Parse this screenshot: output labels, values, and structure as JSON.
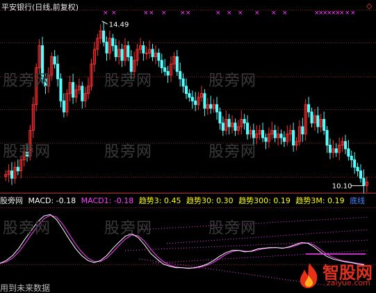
{
  "stock": {
    "title": "平安银行(日线,前复权)",
    "top_right_marker": "◇"
  },
  "watermarks": [
    "股旁网",
    "股旁网",
    "股旁网",
    "股旁网",
    "股旁网",
    "股旁网",
    "股旁网",
    "股旁网",
    "股旁网"
  ],
  "indicator": {
    "name": "股旁网",
    "macd": "MACD: -0.18",
    "macd1": "MACD1: -0.18",
    "trend3": "趋势3: 0.45",
    "trend30": "趋势30: 0.30",
    "trend300": "趋势300: 0.19",
    "trend3m": "趋势3M: 0.19",
    "bottom_line": "底线"
  },
  "bottom_note": "用到未来数据",
  "logo": {
    "name": "智股网",
    "url": "zaiyue.com"
  },
  "colors": {
    "up": "#ff3030",
    "down": "#54ffff",
    "grid": "#8b1a1a",
    "marker": "#ff40ff",
    "macd": "#ffffff",
    "macd1": "#ff40ff",
    "trend3": "#ffff00",
    "trend30": "#ffff00",
    "trend300": "#ffff00",
    "trend3m": "#ffff00",
    "bottom_line": "#4488ff"
  },
  "chart_data": {
    "type": "candlestick",
    "price_labels": {
      "high": "14.49",
      "low": "10.10"
    },
    "price_range": [
      10.0,
      14.8
    ],
    "high": 14.49,
    "low": 10.1,
    "closes": [
      10.4,
      10.5,
      10.3,
      10.6,
      10.5,
      10.8,
      11.0,
      10.9,
      11.6,
      12.3,
      13.3,
      13.9,
      13.0,
      12.8,
      13.1,
      13.6,
      13.4,
      13.0,
      12.4,
      12.1,
      12.6,
      12.9,
      12.5,
      12.7,
      12.8,
      12.4,
      12.6,
      12.8,
      13.4,
      13.8,
      14.1,
      14.3,
      14.0,
      13.7,
      14.1,
      13.9,
      13.6,
      13.8,
      13.5,
      13.9,
      13.6,
      13.2,
      13.5,
      13.8,
      13.9,
      13.7,
      13.7,
      13.8,
      13.6,
      13.7,
      13.5,
      13.3,
      13.2,
      13.1,
      13.4,
      13.6,
      13.2,
      13.0,
      12.8,
      12.6,
      12.5,
      12.4,
      12.3,
      12.5,
      12.6,
      12.2,
      12.3,
      12.2,
      12.3,
      12.1,
      11.8,
      11.6,
      11.9,
      11.7,
      11.8,
      11.6,
      11.7,
      11.9,
      11.8,
      11.5,
      11.6,
      11.4,
      11.5,
      11.6,
      11.4,
      11.3,
      11.5,
      11.6,
      11.4,
      11.5,
      11.4,
      11.3,
      11.5,
      11.6,
      11.2,
      11.3,
      11.7,
      11.5,
      12.3,
      12.1,
      11.8,
      12.0,
      11.7,
      11.9,
      11.6,
      11.2,
      11.0,
      11.1,
      11.0,
      11.2,
      11.3,
      11.1,
      10.9,
      10.8,
      10.6,
      10.5,
      10.3,
      10.1,
      10.2
    ],
    "macd_values": [
      -0.16,
      -0.12,
      -0.05,
      0.05,
      0.18,
      0.3,
      0.42,
      0.5,
      0.52,
      0.45,
      0.32,
      0.18,
      0.05,
      -0.05,
      -0.12,
      -0.15,
      -0.12,
      -0.05,
      0.05,
      0.14,
      0.22,
      0.25,
      0.2,
      0.1,
      -0.02,
      -0.1,
      -0.17,
      -0.2,
      -0.22,
      -0.22,
      -0.23,
      -0.22,
      -0.2,
      -0.17,
      -0.12,
      -0.06,
      -0.01,
      0.02,
      0.02,
      0.0,
      0.01,
      0.04,
      0.05,
      0.06,
      0.06,
      0.05,
      0.07,
      0.1,
      0.13,
      0.12,
      0.07,
      0.0,
      -0.06,
      -0.1,
      -0.12,
      -0.14,
      -0.15,
      -0.17,
      -0.18
    ]
  }
}
